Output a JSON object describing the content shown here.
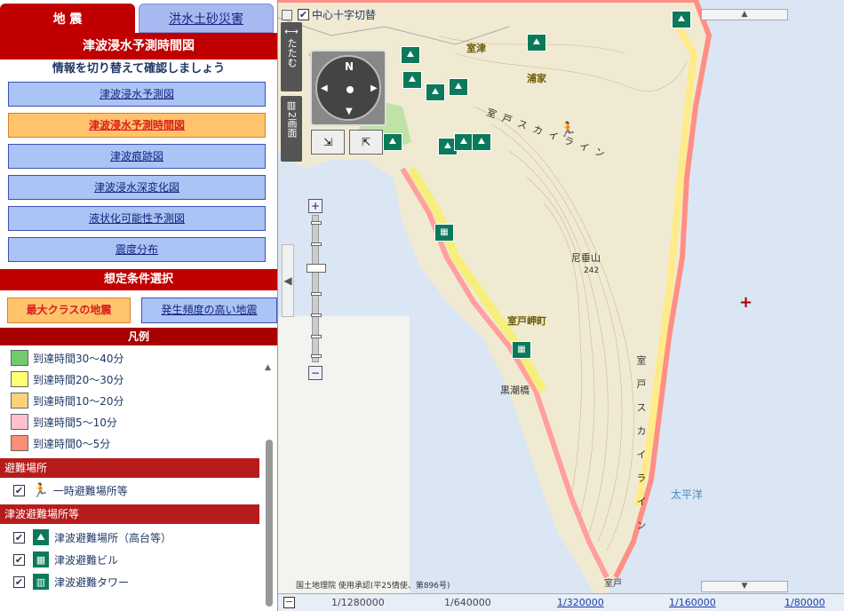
{
  "tabs": {
    "active": "地 震",
    "inactive": "洪水土砂災害"
  },
  "panel_title": "津波浸水予測時間図",
  "subtitle": "情報を切り替えて確認しましょう",
  "nav_buttons": [
    {
      "label": "津波浸水予測図",
      "selected": false
    },
    {
      "label": "津波浸水予測時間図",
      "selected": true
    },
    {
      "label": "津波痕跡図",
      "selected": false
    },
    {
      "label": "津波浸水深変化図",
      "selected": false
    },
    {
      "label": "液状化可能性予測図",
      "selected": false
    },
    {
      "label": "震度分布",
      "selected": false
    }
  ],
  "conditions": {
    "title": "想定条件選択",
    "max": "最大クラスの地震",
    "frequent": "発生頻度の高い地震"
  },
  "legend": {
    "title": "凡例",
    "items": [
      {
        "label": "到達時間30～40分",
        "color": "#73c96e"
      },
      {
        "label": "到達時間20～30分",
        "color": "#ffff73"
      },
      {
        "label": "到達時間10～20分",
        "color": "#ffd07a"
      },
      {
        "label": "到達時間5～10分",
        "color": "#ffc0cb"
      },
      {
        "label": "到達時間0～5分",
        "color": "#ff8c78"
      }
    ],
    "shelter_header": "避難場所",
    "shelter_item": "一時避難場所等",
    "tsunami_header": "津波避難場所等",
    "tsunami_items": [
      "津波避難場所（高台等）",
      "津波避難ビル",
      "津波避難タワー"
    ]
  },
  "map": {
    "crosshair_label": "中心十字切替",
    "collapse_label": "たたむ",
    "split_label": "2画面",
    "compass_n": "N",
    "labels": {
      "muro": "室津",
      "urado": "浦家",
      "sky1": "室 戸 ス カ イ ラ イ ン",
      "mtn": "尼垂山",
      "elev": "242",
      "town": "室戸岬町",
      "kuroshio": "黒潮橋",
      "sky2": "室 戸 ス カ イ ラ イ ン",
      "ocean": "太平洋",
      "muro2": "室戸"
    },
    "credit": "国土地理院 使用承認(平25情使、第896号)"
  },
  "scales": [
    {
      "label": "1/1280000",
      "link": false
    },
    {
      "label": "1/640000",
      "link": false
    },
    {
      "label": "1/320000",
      "link": true
    },
    {
      "label": "1/160000",
      "link": true
    },
    {
      "label": "1/80000",
      "link": true
    }
  ]
}
